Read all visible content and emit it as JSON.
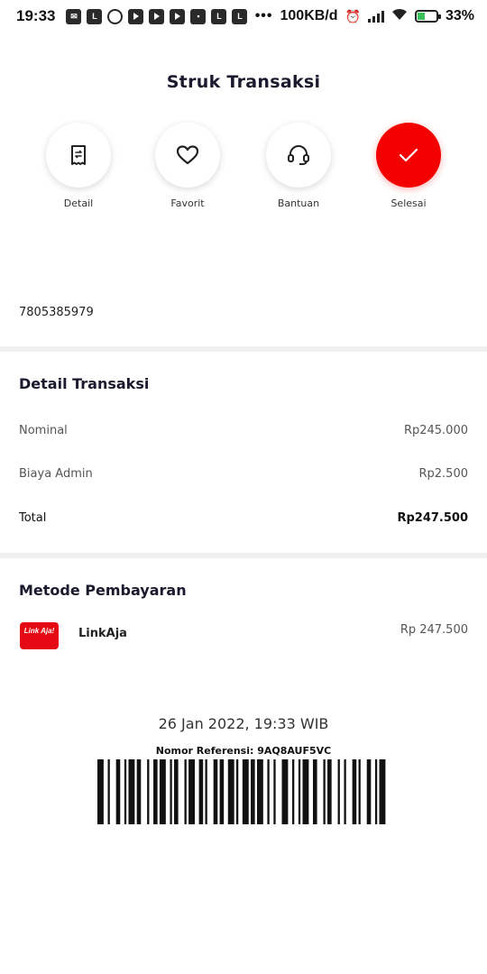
{
  "status_bar": {
    "time": "19:33",
    "net_speed": "100KB/d",
    "battery": "33%"
  },
  "header": {
    "title": "Struk Transaksi"
  },
  "actions": [
    {
      "label": "Detail",
      "icon": "receipt-icon"
    },
    {
      "label": "Favorit",
      "icon": "heart-icon"
    },
    {
      "label": "Bantuan",
      "icon": "headset-icon"
    },
    {
      "label": "Selesai",
      "icon": "check-icon",
      "active": true
    }
  ],
  "account": {
    "number": "7805385979"
  },
  "detail": {
    "title": "Detail Transaksi",
    "rows": [
      {
        "label": "Nominal",
        "value": "Rp245.000"
      },
      {
        "label": "Biaya Admin",
        "value": "Rp2.500"
      },
      {
        "label": "Total",
        "value": "Rp247.500"
      }
    ]
  },
  "payment": {
    "title": "Metode Pembayaran",
    "method": "LinkAja",
    "logo_text": "Link Aja!",
    "amount": "Rp 247.500"
  },
  "footer": {
    "date": "26 Jan 2022, 19:33 WIB",
    "reference": "Nomor Referensi: 9AQ8AUF5VC"
  },
  "colors": {
    "accent": "#f40000",
    "linkaja": "#e50914"
  }
}
